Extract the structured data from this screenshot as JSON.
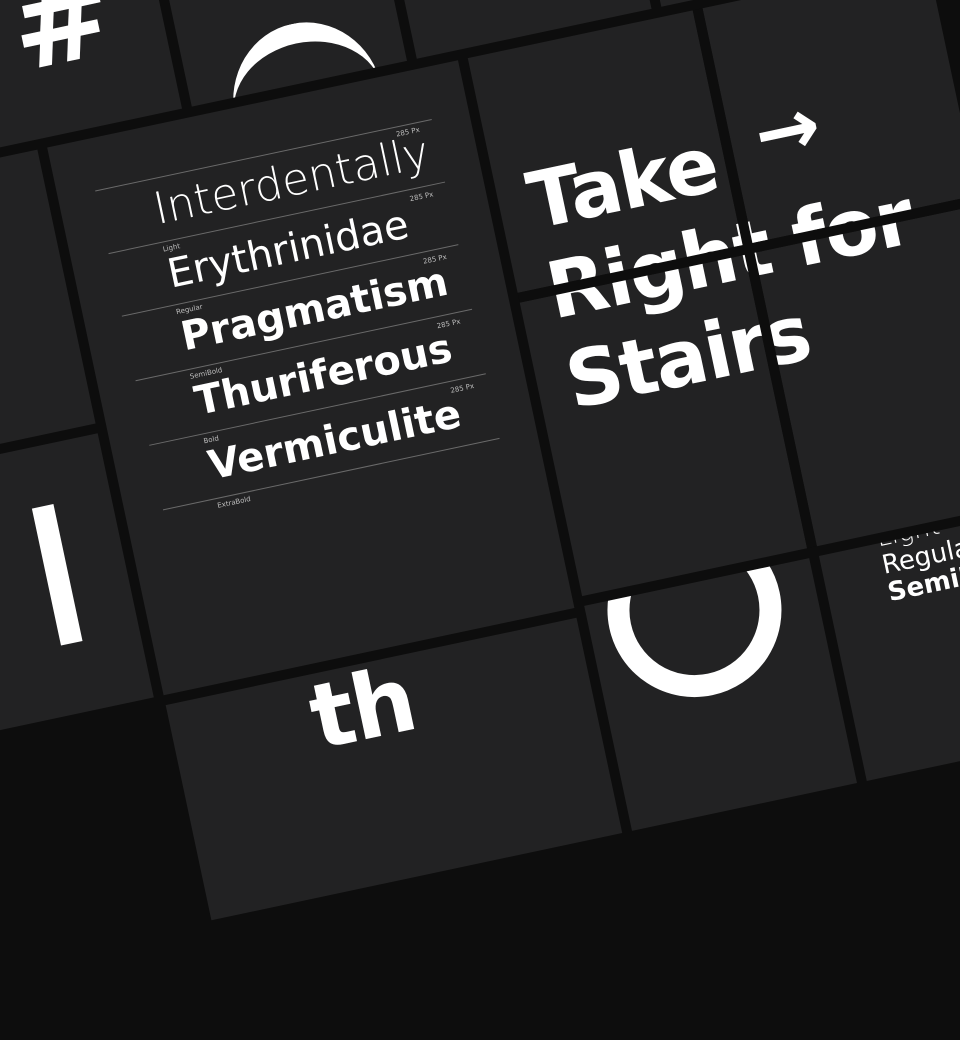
{
  "hash_symbol": "#",
  "poster": {
    "line1": "Take",
    "arrow": "→",
    "line2": "Right for",
    "line3": "Stairs"
  },
  "specimen": [
    {
      "weight": "Light",
      "word": "Interdentally",
      "size": "285 Px"
    },
    {
      "weight": "Regular",
      "word": "Erythrinidae",
      "size": "285 Px"
    },
    {
      "weight": "SemiBold",
      "word": "Pragmatism",
      "size": "285 Px"
    },
    {
      "weight": "Bold",
      "word": "Thuriferous",
      "size": "285 Px"
    },
    {
      "weight": "ExtraBold",
      "word": "Vermiculite",
      "size": "285 Px"
    }
  ],
  "weights_list": [
    "Light",
    "Regular",
    "SemiBold"
  ],
  "fragment_text": "th",
  "colors": {
    "background": "#0d0d0d",
    "tile": "#222223",
    "text": "#ffffff",
    "rule": "#6a6a6a"
  }
}
